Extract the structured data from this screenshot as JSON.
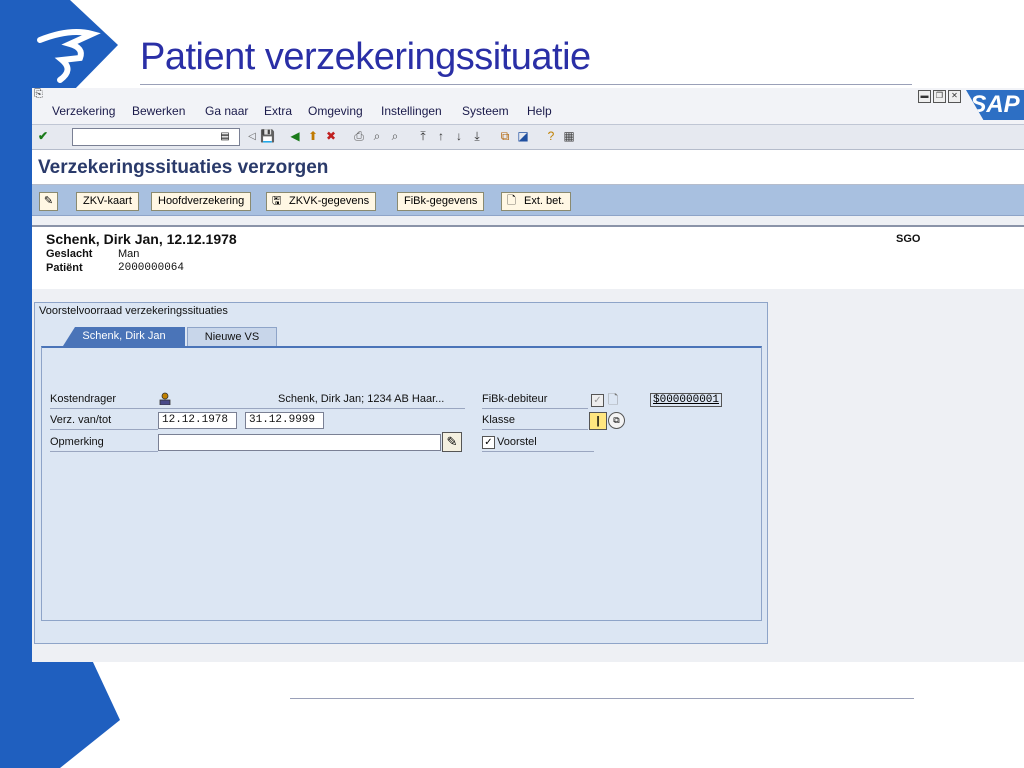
{
  "slide": {
    "title": "Patient verzekeringssituatie"
  },
  "menu": {
    "items": [
      "Verzekering",
      "Bewerken",
      "Ga naar",
      "Extra",
      "Omgeving",
      "Instellingen",
      "Systeem",
      "Help"
    ]
  },
  "sap": {
    "logo_text": "SAP"
  },
  "screen": {
    "title": "Verzekeringssituaties verzorgen"
  },
  "appbar": {
    "zkv_kaart": "ZKV-kaart",
    "hoofdverzekering": "Hoofdverzekering",
    "zkvk_gegevens": "ZKVK-gegevens",
    "fibk_gegevens": "FiBk-gegevens",
    "ext_bet": "Ext. bet."
  },
  "patient": {
    "name": "Schenk, Dirk Jan, 12.12.1978",
    "org": "SGO",
    "gender_label": "Geslacht",
    "gender_value": "Man",
    "patient_label": "Patiënt",
    "patient_value": "2000000064"
  },
  "panel": {
    "caption": "Voorstelvoorraad verzekeringssituaties",
    "tabs": [
      "Schenk, Dirk Jan",
      "Nieuwe VS"
    ]
  },
  "form": {
    "kostendrager_label": "Kostendrager",
    "kostendrager_value": "Schenk, Dirk Jan; 1234 AB Haar...",
    "verz_label": "Verz. van/tot",
    "verz_from": "12.12.1978",
    "verz_to": "31.12.9999",
    "opmerking_label": "Opmerking",
    "opmerking_value": "",
    "fibk_label": "FiBk-debiteur",
    "fibk_value": "$000000001",
    "klasse_label": "Klasse",
    "voorstel_label": "Voorstel",
    "voorstel_checked": true
  }
}
